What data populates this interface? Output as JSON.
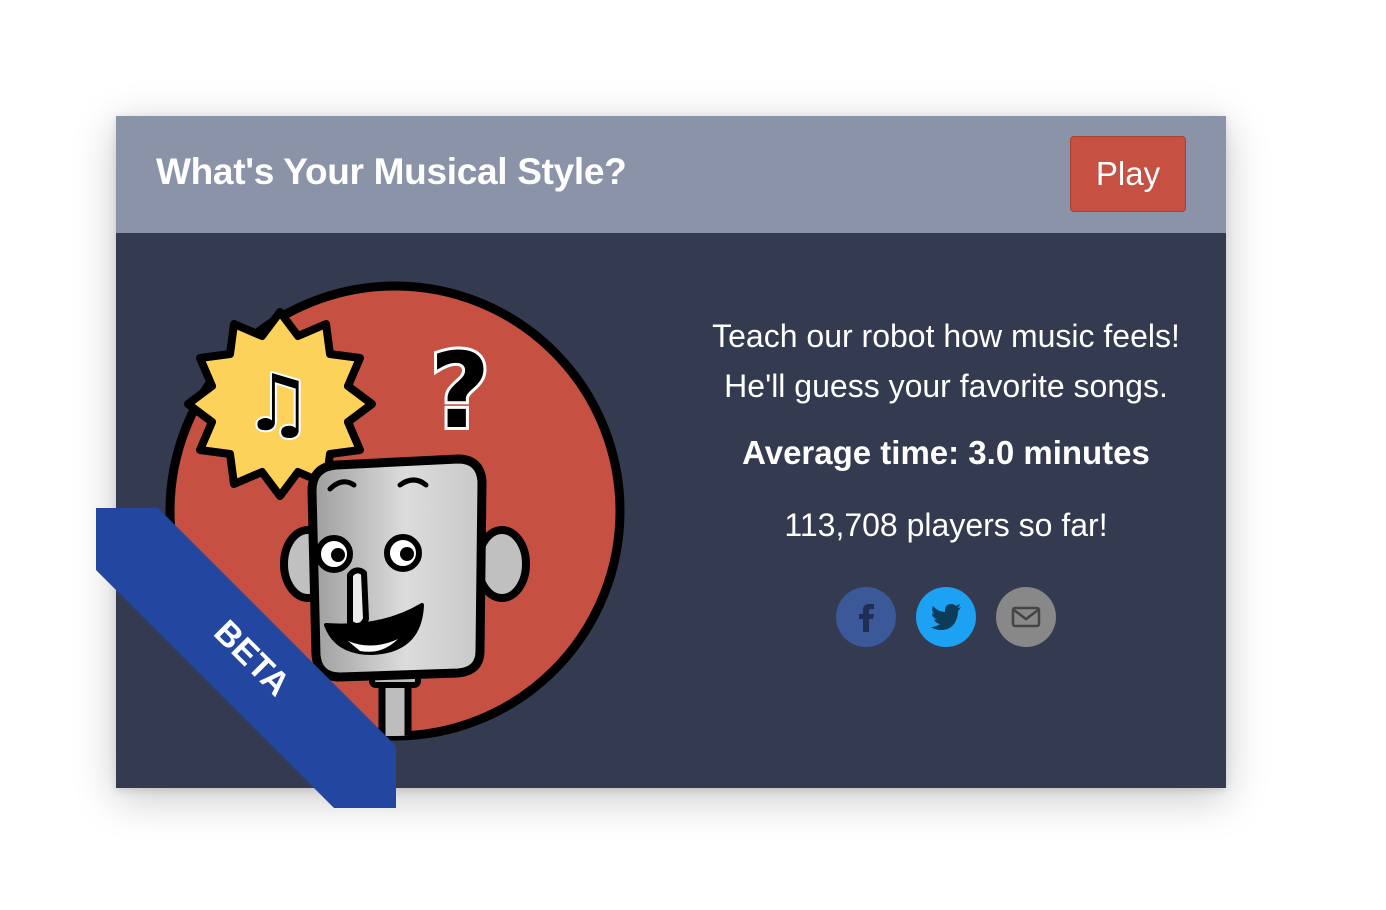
{
  "card": {
    "title": "What's Your Musical Style?",
    "play_label": "Play",
    "description": "Teach our robot how music feels! He'll guess your favorite songs.",
    "average_time": "Average time: 3.0 minutes",
    "players": "113,708 players so far!",
    "badge": "BETA"
  },
  "illustration": {
    "icon": "robot-music-icon",
    "note_glyph": "♫",
    "question_glyph": "?"
  },
  "share": [
    {
      "name": "facebook",
      "icon": "facebook-icon",
      "color": "#3b5998"
    },
    {
      "name": "twitter",
      "icon": "twitter-icon",
      "color": "#1da1f2"
    },
    {
      "name": "email",
      "icon": "email-icon",
      "color": "#888888"
    }
  ],
  "colors": {
    "header_bg": "#8a93a7",
    "body_bg": "#343b50",
    "play_button": "#c65143",
    "circle": "#c65143",
    "ribbon": "#2346a0",
    "burst": "#fcd25a"
  }
}
